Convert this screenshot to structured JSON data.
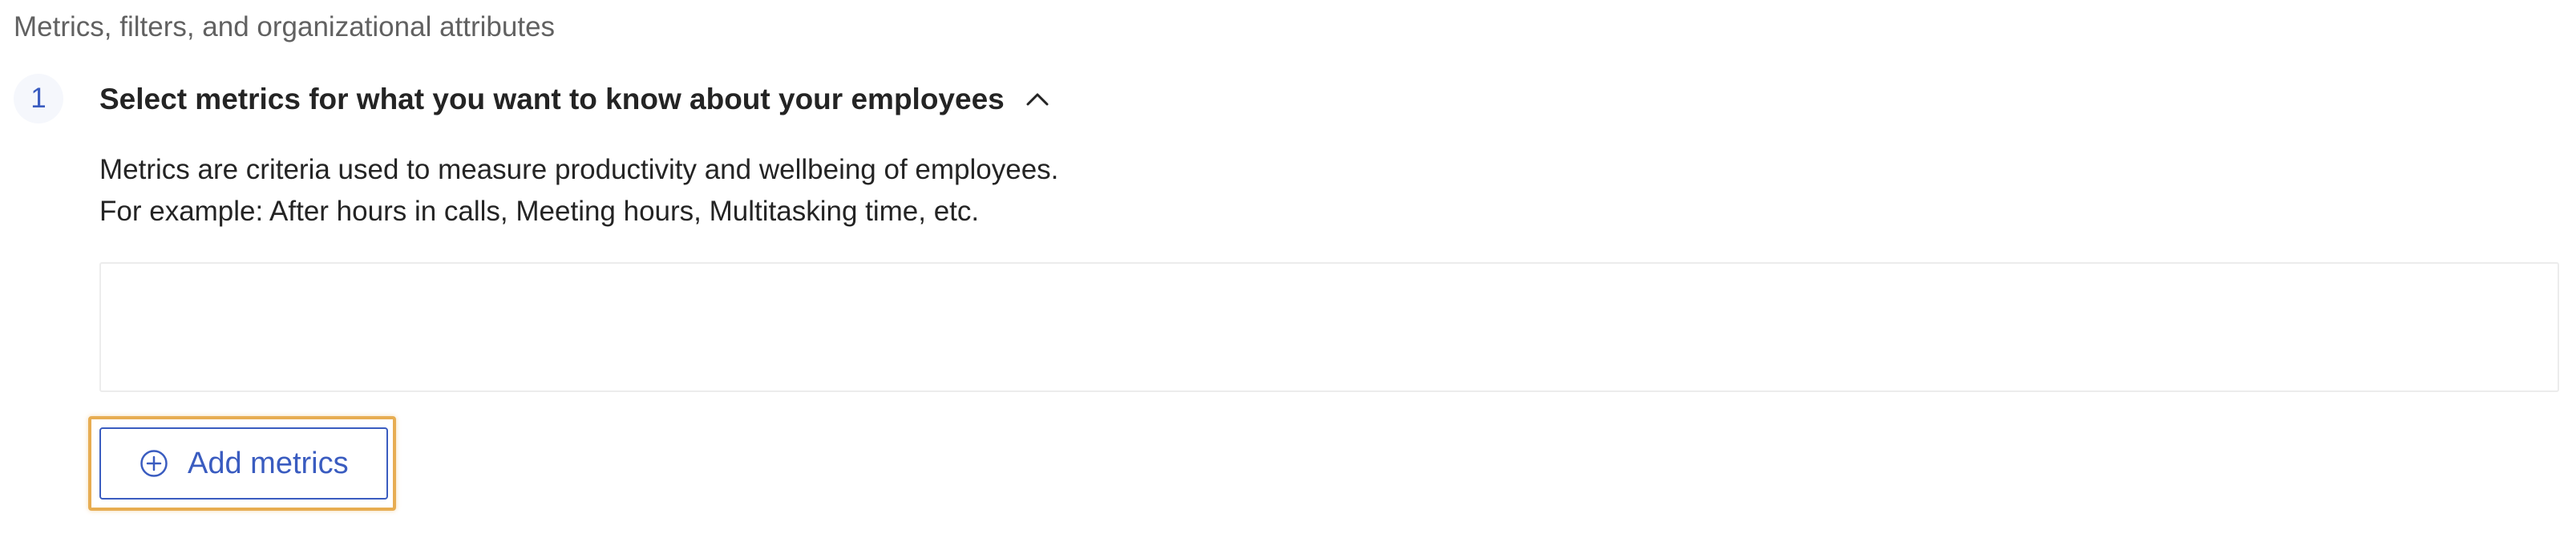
{
  "section": {
    "label": "Metrics, filters, and organizational attributes"
  },
  "step": {
    "number": "1",
    "title": "Select metrics for what you want to know about your employees",
    "expanded": true,
    "description_line1": "Metrics are criteria used to measure productivity and wellbeing of employees.",
    "description_line2": "For example: After hours in calls, Meeting hours, Multitasking time, etc.",
    "add_button_label": "Add metrics",
    "add_button_icon": "plus-circle-icon",
    "collapse_icon": "chevron-up-icon"
  },
  "colors": {
    "accent": "#3a5cc0",
    "highlight": "#e7ad52",
    "text": "#242424",
    "muted_text": "#616161"
  }
}
